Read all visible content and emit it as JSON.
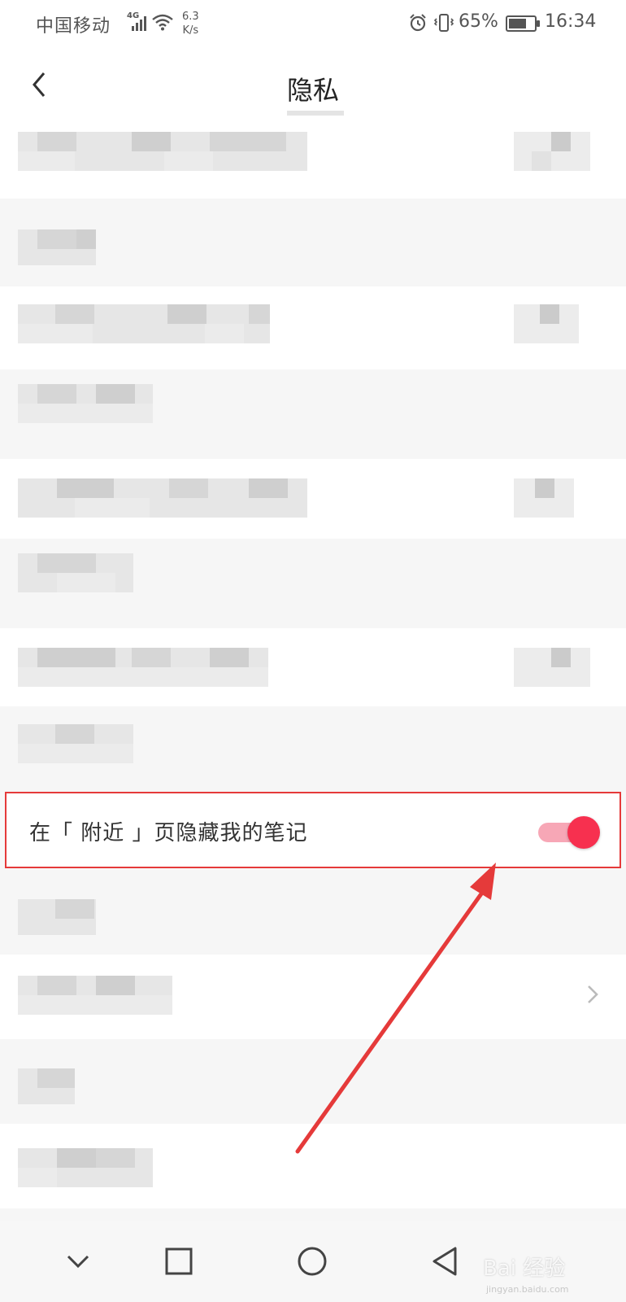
{
  "status_bar": {
    "carrier": "中国移动",
    "network": "4G",
    "speed_value": "6.3",
    "speed_unit": "K/s",
    "battery": "65%",
    "battery_level": 0.65,
    "time": "16:34"
  },
  "header": {
    "title": "隐私",
    "back_icon": "chevron-left-icon"
  },
  "highlight_row": {
    "label": "在「 附近 」页隐藏我的笔记",
    "toggle_on": true,
    "toggle_color": "#f7304f",
    "highlight_color": "#e53a3a"
  },
  "annotation": {
    "arrow_color": "#e53a3a"
  },
  "system_nav": {
    "icons": [
      "chevron-down-icon",
      "recent-apps-icon",
      "home-icon",
      "back-triangle-icon"
    ]
  },
  "watermark": {
    "brand": "Bai 经验",
    "url": "jingyan.baidu.com"
  }
}
